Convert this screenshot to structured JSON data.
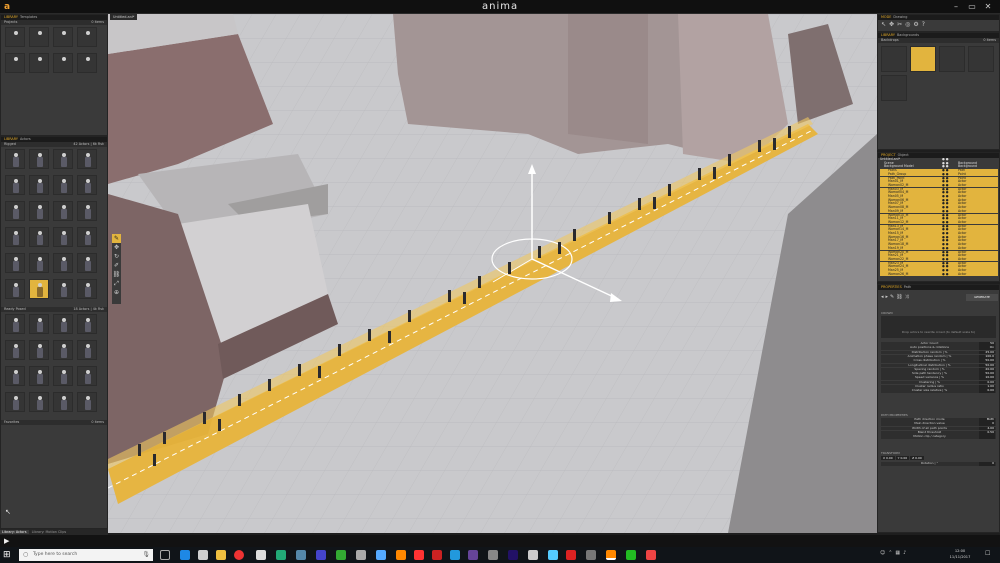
{
  "window": {
    "app_name": "anima"
  },
  "left_top_panel": {
    "header_tag": "LIBRARY",
    "header_title": "Templates",
    "section_label": "Projects",
    "section_count": "0 items"
  },
  "left_actors_panel": {
    "header_tag": "LIBRARY",
    "header_title": "Actors",
    "rigged_label": "Rigged",
    "rigged_count": "42 Actors | 6k Rsk",
    "ready_label": "Ready Posed",
    "ready_count": "18 Actors | 4k Rsk",
    "favorites_label": "Favorites",
    "favorites_count": "0 items"
  },
  "left_tabs": {
    "t1": "Library: Actors",
    "t2": "Library: Motion Clips"
  },
  "viewport": {
    "tab_label": "Untitled.ani*"
  },
  "right_mode": {
    "tag": "MODE",
    "title": "Drawing"
  },
  "right_bg": {
    "tag": "LIBRARY",
    "title": "Backgrounds",
    "sub": "Backdrops",
    "count": "0 items"
  },
  "outliner": {
    "tag": "PROJECT",
    "title": "Object",
    "rows": [
      {
        "name": "Untitled.ani*",
        "type": ""
      },
      {
        "name": "Scene",
        "type": "Background"
      },
      {
        "name": "Background Model",
        "type": "Background"
      },
      {
        "name": "Paths",
        "type": "Path"
      },
      {
        "name": "Path_Group",
        "type": "Point"
      },
      {
        "name": "Path_Point",
        "type": "Point"
      },
      {
        "name": "Man01_M",
        "type": "Actor"
      },
      {
        "name": "Woman02_M",
        "type": "Actor"
      },
      {
        "name": "Man03_M",
        "type": "Actor"
      },
      {
        "name": "Woman04_M",
        "type": "Actor"
      },
      {
        "name": "Man05_M",
        "type": "Actor"
      },
      {
        "name": "Woman06_M",
        "type": "Actor"
      },
      {
        "name": "Man07_M",
        "type": "Actor"
      },
      {
        "name": "Woman08_M",
        "type": "Actor"
      },
      {
        "name": "Man09_M",
        "type": "Actor"
      },
      {
        "name": "Woman10_M",
        "type": "Actor"
      },
      {
        "name": "Man11_M",
        "type": "Actor"
      },
      {
        "name": "Woman12_M",
        "type": "Actor"
      },
      {
        "name": "Man13_M",
        "type": "Actor"
      },
      {
        "name": "Woman14_M",
        "type": "Actor"
      },
      {
        "name": "Man15_M",
        "type": "Actor"
      },
      {
        "name": "Woman16_M",
        "type": "Actor"
      },
      {
        "name": "Man17_M",
        "type": "Actor"
      },
      {
        "name": "Woman18_M",
        "type": "Actor"
      },
      {
        "name": "Man19_M",
        "type": "Actor"
      },
      {
        "name": "Woman20_M",
        "type": "Actor"
      },
      {
        "name": "Man21_M",
        "type": "Actor"
      },
      {
        "name": "Woman22_M",
        "type": "Actor"
      },
      {
        "name": "Man23_M",
        "type": "Actor"
      },
      {
        "name": "Woman24_M",
        "type": "Actor"
      },
      {
        "name": "Man25_M",
        "type": "Actor"
      },
      {
        "name": "Woman26_M",
        "type": "Actor"
      }
    ]
  },
  "properties": {
    "tag": "PROPERTIES",
    "title": "Path",
    "generate_label": "GENERATE",
    "crowd_label": "CROWD",
    "drop_hint": "Drop actors to rewrite crowd (to default scale to)",
    "rows": [
      {
        "label": "Actor Count",
        "value": "50"
      },
      {
        "label": "Auto positions & rotations",
        "value": "On"
      },
      {
        "label": "Distribution random | %",
        "value": "25.00"
      },
      {
        "label": "Animation phase random | %",
        "value": "100.0"
      },
      {
        "label": "Cross distribution | %",
        "value": "50.00"
      },
      {
        "label": "Longitudinal distribution | %",
        "value": "50.00"
      },
      {
        "label": "Spacing random | %",
        "value": "20.00"
      },
      {
        "label": "Side path tendency | %",
        "value": "50.00"
      },
      {
        "label": "Speed variance | %",
        "value": "10.00"
      },
      {
        "label": "Clustering | %",
        "value": "0.00"
      },
      {
        "label": "Cluster radius ratio",
        "value": "1.00"
      },
      {
        "label": "Cluster size relative | %",
        "value": "0.00"
      }
    ],
    "path_section": "PATH PROPERTIES",
    "path_rows": [
      {
        "label": "Path direction mode",
        "value": "Both"
      },
      {
        "label": "Main direction value",
        "value": "0"
      },
      {
        "label": "Width of all path points",
        "value": "4.00"
      },
      {
        "label": "Blend threshold",
        "value": "0.50"
      },
      {
        "label": "Motion clip / category",
        "value": ""
      }
    ],
    "transform_section": "TRANSFORM",
    "transform_x": "0.00",
    "transform_y": "0.00",
    "transform_z": "0.00",
    "rotation_label": "Rotation | °",
    "rotation_value": "0"
  },
  "taskbar": {
    "search_placeholder": "Type here to search",
    "time": "12:00",
    "date": "11/11/2017"
  },
  "colors": {
    "accent": "#e2b43e",
    "path": "#e8b43a"
  }
}
